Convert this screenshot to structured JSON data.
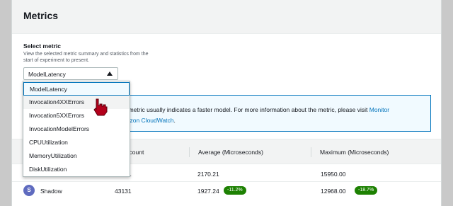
{
  "panel": {
    "title": "Metrics"
  },
  "select": {
    "label": "Select metric",
    "description": "View the selected metric summary and statistics from the start of experiment to present.",
    "value": "ModelLatency",
    "options": [
      "ModelLatency",
      "Invocation4XXErrors",
      "Invocation5XXErrors",
      "InvocationModelErrors",
      "CPUUtilization",
      "MemoryUtilization",
      "DiskUtilization"
    ]
  },
  "info": {
    "text": "ncy metric usually indicates a faster model. For more information about the metric, please visit",
    "link1": "Monitor",
    "link2": "Amazon CloudWatch",
    "end": "."
  },
  "table": {
    "headers": [
      "ample count",
      "Average (Microseconds)",
      "Maximum (Microseconds)"
    ],
    "rows": [
      {
        "variant": "",
        "avatar": "",
        "count": "43131",
        "average": "2170.21",
        "avg_badge": "",
        "maximum": "15950.00",
        "max_badge": ""
      },
      {
        "variant": "Shadow",
        "avatar": "S",
        "count": "43131",
        "average": "1927.24",
        "avg_badge": "-11.2%",
        "maximum": "12968.00",
        "max_badge": "-18.7%"
      }
    ]
  },
  "colors": {
    "accent": "#0073bb",
    "badge_green": "#1d8102",
    "avatar": "#5f6bbf",
    "cursor": "#b3001b"
  },
  "icons": {
    "caret": "caret-up-icon",
    "cursor": "hand-pointer-icon"
  }
}
